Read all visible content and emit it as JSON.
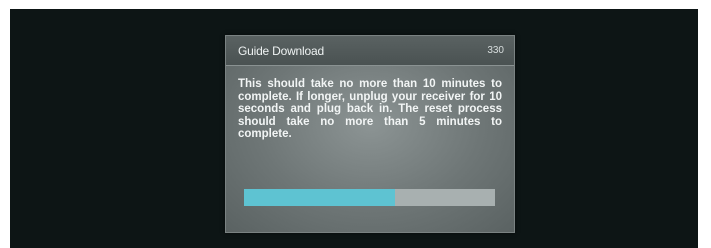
{
  "dialog": {
    "title": "Guide Download",
    "code": "330",
    "message": "This should take no more than 10 minutes to complete. If longer, unplug your receiver for 10 seconds and plug back in. The reset process should take no more than 5 minutes to complete."
  },
  "progress": {
    "fraction": 0.6,
    "fill_color": "#5ec3d2",
    "track_color": "#a8b0b0"
  }
}
